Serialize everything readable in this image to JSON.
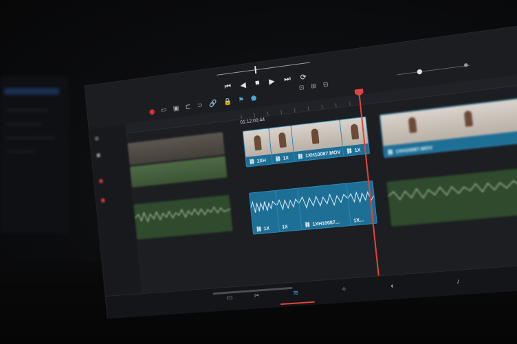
{
  "transport": {
    "first_icon": "⏮",
    "back_icon": "◀",
    "stop_icon": "■",
    "play_icon": "▶",
    "last_icon": "⏭",
    "loop_icon": "⟳"
  },
  "timeline": {
    "timecode": "01:12:00:44",
    "clips": {
      "v_clip_1_label": "1XH",
      "v_clip_2_label": "1X",
      "v_clip_3_label": "1XH10087.MOV",
      "v_clip_4_label": "1X",
      "v_clip_right_label": "1XH10087.MOV",
      "a_clip_1_label": "1X",
      "a_clip_2_label": "1X",
      "a_clip_3_label": "1XH10087...",
      "a_clip_4_label": "1X..."
    }
  },
  "colors": {
    "accent_blue": "#1e6f96",
    "playhead_red": "#e2423d",
    "audio_green": "#2f4a2c"
  }
}
